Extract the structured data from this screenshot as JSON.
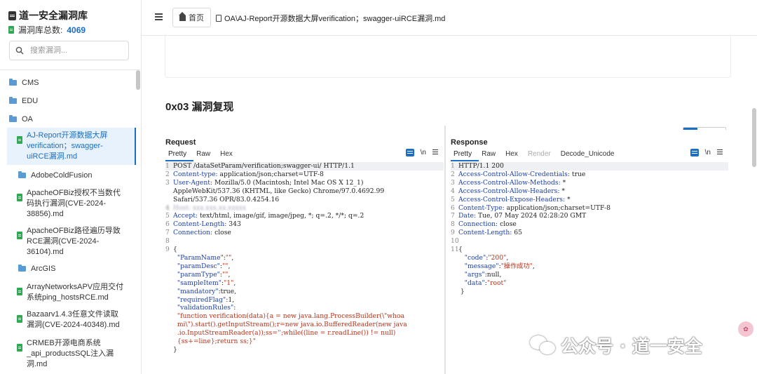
{
  "sidebar": {
    "title": "道一安全漏洞库",
    "count_label": "漏洞库总数:",
    "count_value": "4069",
    "search_placeholder": "搜索漏洞...",
    "folders_top": [
      "CMS",
      "EDU",
      "OA"
    ],
    "items": [
      {
        "type": "file",
        "label": "AJ-Report开源数据大屏verification；swagger-uiRCE漏洞.md",
        "active": true
      },
      {
        "type": "folder",
        "label": "AdobeColdFusion"
      },
      {
        "type": "file",
        "label": "ApacheOFBiz授权不当数代码执行漏洞(CVE-2024-38856).md"
      },
      {
        "type": "file",
        "label": "ApacheOFBiz路径遍历导致RCE漏洞(CVE-2024-36104).md"
      },
      {
        "type": "folder",
        "label": "ArcGIS"
      },
      {
        "type": "file",
        "label": "ArrayNetworksAPV应用交付系统ping_hostsRCE.md"
      },
      {
        "type": "file",
        "label": "Bazaarv1.4.3任意文件读取漏洞(CVE-2024-40348).md"
      },
      {
        "type": "file",
        "label": "CRMEB开源电商系统_api_productsSQL注入漏洞.md"
      }
    ]
  },
  "topbar": {
    "home_label": "首页",
    "breadcrumb": "OA\\AJ-Report开源数据大屏verification；swagger-uiRCE漏洞.md"
  },
  "main": {
    "section_title": "0x03 漏洞复现"
  },
  "request": {
    "title": "Request",
    "tabs": [
      "Pretty",
      "Raw",
      "Hex"
    ],
    "wrap_label": "\\n"
  },
  "response": {
    "title": "Response",
    "tabs": [
      "Pretty",
      "Raw",
      "Hex",
      "Render",
      "Decode_Unicode"
    ],
    "wrap_label": "\\n"
  },
  "watermark": {
    "text": "公众号 · 道一安全"
  },
  "colors": {
    "accent": "#1a6fc4",
    "count": "#1a6fc4",
    "file_icon": "#2eaa52",
    "folder_icon": "#5b9bd5",
    "code_key": "#1a3fa8",
    "code_string": "#b4321a"
  },
  "icons": {
    "menu": "menu-icon",
    "home": "home-icon",
    "search": "search-icon",
    "wrap": "wrap-lines-icon",
    "newline": "newline-icon"
  }
}
